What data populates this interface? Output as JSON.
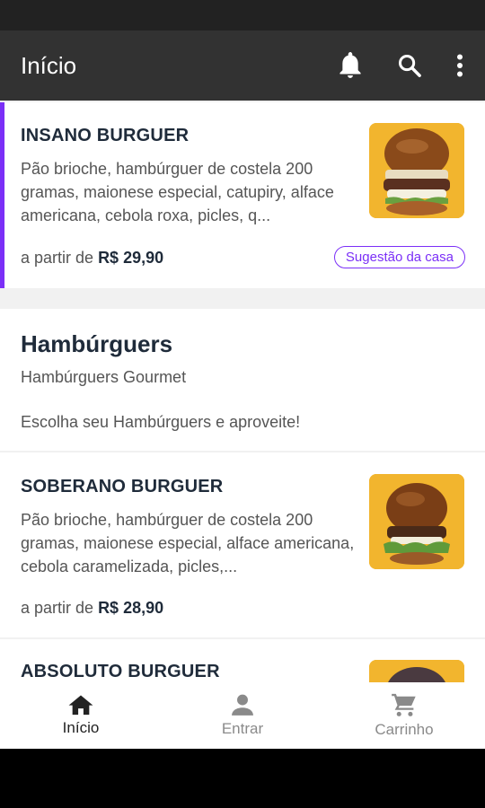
{
  "app_bar": {
    "title": "Início",
    "icons": [
      "bell-icon",
      "search-icon",
      "more-vert-icon"
    ]
  },
  "featured_product": {
    "name": "INSANO BURGUER",
    "description": "Pão brioche, hambúrguer de costela 200 gramas, maionese especial, catupiry, alface americana, cebola roxa, picles, q...",
    "price_prefix": "a partir de",
    "price": "R$ 29,90",
    "badge": "Sugestão da casa"
  },
  "category": {
    "title": "Hambúrguers",
    "subtitle": "Hambúrguers Gourmet",
    "description": "Escolha seu Hambúrguers e aproveite!"
  },
  "products": [
    {
      "name": "SOBERANO BURGUER",
      "description": "Pão brioche, hambúrguer de costela 200 gramas, maionese especial, alface americana,  cebola caramelizada, picles,...",
      "price_prefix": "a partir de",
      "price": "R$ 28,90"
    },
    {
      "name": "ABSOLUTO BURGUER"
    }
  ],
  "bottom_nav": {
    "items": [
      {
        "label": "Início",
        "icon": "home-icon",
        "active": true
      },
      {
        "label": "Entrar",
        "icon": "person-icon",
        "active": false
      },
      {
        "label": "Carrinho",
        "icon": "cart-icon",
        "active": false
      }
    ]
  },
  "colors": {
    "accent": "#7b2ff7",
    "app_bar": "#323232",
    "image_bg": "#f2b52e"
  }
}
